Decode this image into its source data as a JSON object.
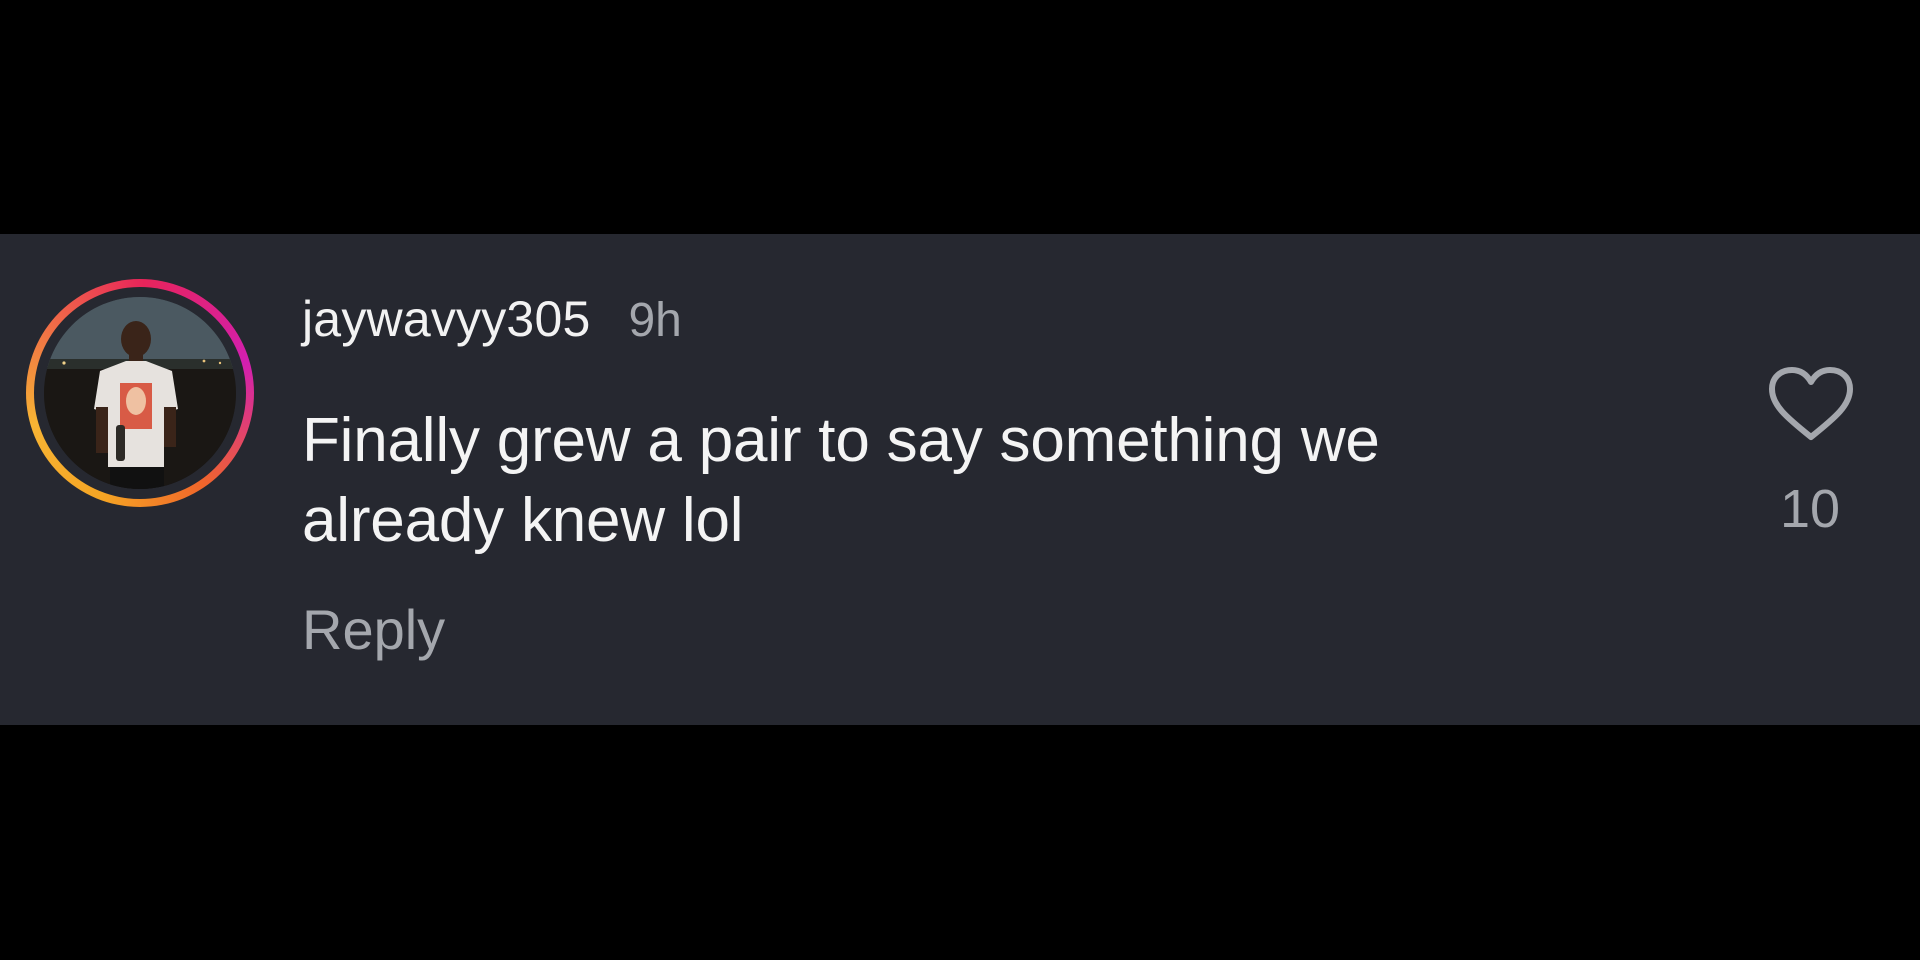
{
  "comment": {
    "username": "jaywavyy305",
    "timestamp": "9h",
    "text_lines": [
      "Finally grew a pair to say something we",
      "already knew lol"
    ],
    "reply_label": "Reply",
    "like_count": "10",
    "like_icon": "heart-outline-icon"
  },
  "colors": {
    "background": "#000000",
    "panel": "#262830",
    "primary_text": "#f2f2f2",
    "secondary_text": "#a4a7ad",
    "story_ring": [
      "#f5a524",
      "#e8245a",
      "#d21fb0"
    ]
  }
}
